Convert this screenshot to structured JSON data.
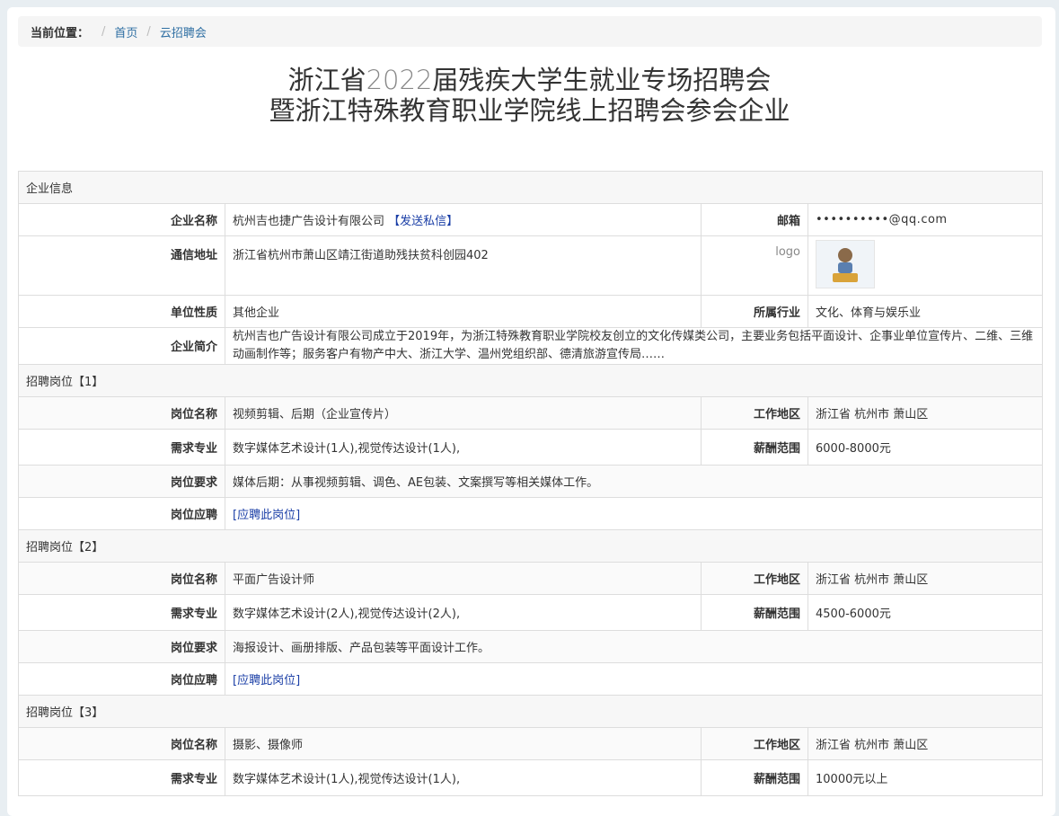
{
  "breadcrumb": {
    "label": "当前位置：",
    "items": [
      "首页",
      "云招聘会"
    ]
  },
  "title": {
    "line1_a": "浙江省",
    "line1_num": "2022",
    "line1_b": "届残疾大学生就业专场招聘会",
    "line2": "暨浙江特殊教育职业学院线上招聘会参会企业"
  },
  "company": {
    "section": "企业信息",
    "name_label": "企业名称",
    "name": "杭州吉也捷广告设计有限公司",
    "send_msg": "【发送私信】",
    "email_label": "邮箱",
    "email": "••••••••••@qq.com",
    "address_label": "通信地址",
    "address": "浙江省杭州市萧山区靖江街道助残扶贫科创园402",
    "logo_label": "logo",
    "nature_label": "单位性质",
    "nature": "其他企业",
    "industry_label": "所属行业",
    "industry": "文化、体育与娱乐业",
    "intro_label": "企业简介",
    "intro": "杭州吉也广告设计有限公司成立于2019年，为浙江特殊教育职业学院校友创立的文化传媒类公司，主要业务包括平面设计、企事业单位宣传片、二维、三维动画制作等；服务客户有物产中大、浙江大学、温州党组织部、德清旅游宣传局……"
  },
  "labels": {
    "job_name": "岗位名称",
    "area": "工作地区",
    "major": "需求专业",
    "salary": "薪酬范围",
    "requirement": "岗位要求",
    "apply": "岗位应聘"
  },
  "jobs": [
    {
      "section": "招聘岗位【1】",
      "name": "视频剪辑、后期（企业宣传片）",
      "area": "浙江省 杭州市 萧山区",
      "major": "数字媒体艺术设计(1人),视觉传达设计(1人),",
      "salary": "6000-8000元",
      "requirement": "媒体后期：从事视频剪辑、调色、AE包装、文案撰写等相关媒体工作。",
      "apply": "[应聘此岗位]"
    },
    {
      "section": "招聘岗位【2】",
      "name": "平面广告设计师",
      "area": "浙江省 杭州市 萧山区",
      "major": "数字媒体艺术设计(2人),视觉传达设计(2人),",
      "salary": "4500-6000元",
      "requirement": "海报设计、画册排版、产品包装等平面设计工作。",
      "apply": "[应聘此岗位]"
    },
    {
      "section": "招聘岗位【3】",
      "name": "摄影、摄像师",
      "area": "浙江省 杭州市 萧山区",
      "major": "数字媒体艺术设计(1人),视觉传达设计(1人),",
      "salary": "10000元以上"
    }
  ]
}
